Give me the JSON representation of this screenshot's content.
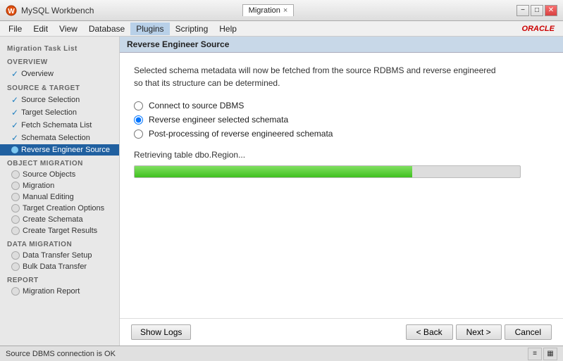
{
  "titleBar": {
    "appName": "MySQL Workbench",
    "tab": "Migration",
    "closeTabLabel": "×"
  },
  "menuBar": {
    "items": [
      "File",
      "Edit",
      "View",
      "Database",
      "Plugins",
      "Scripting",
      "Help"
    ],
    "activeItem": "Plugins",
    "oracleLogo": "ORACLE"
  },
  "sidebar": {
    "title": "Migration Task List",
    "sections": [
      {
        "label": "OVERVIEW",
        "items": [
          {
            "label": "Overview",
            "state": "check",
            "active": false
          }
        ]
      },
      {
        "label": "SOURCE & TARGET",
        "items": [
          {
            "label": "Source Selection",
            "state": "check",
            "active": false
          },
          {
            "label": "Target Selection",
            "state": "check",
            "active": false
          },
          {
            "label": "Fetch Schemata List",
            "state": "check",
            "active": false
          },
          {
            "label": "Schemata Selection",
            "state": "check",
            "active": false
          },
          {
            "label": "Reverse Engineer Source",
            "state": "active",
            "active": true
          }
        ]
      },
      {
        "label": "OBJECT MIGRATION",
        "items": [
          {
            "label": "Source Objects",
            "state": "circle",
            "active": false
          },
          {
            "label": "Migration",
            "state": "circle",
            "active": false
          },
          {
            "label": "Manual Editing",
            "state": "circle",
            "active": false
          },
          {
            "label": "Target Creation Options",
            "state": "circle",
            "active": false
          },
          {
            "label": "Create Schemata",
            "state": "circle",
            "active": false
          },
          {
            "label": "Create Target Results",
            "state": "circle",
            "active": false
          }
        ]
      },
      {
        "label": "DATA MIGRATION",
        "items": [
          {
            "label": "Data Transfer Setup",
            "state": "circle",
            "active": false
          },
          {
            "label": "Bulk Data Transfer",
            "state": "circle",
            "active": false
          }
        ]
      },
      {
        "label": "REPORT",
        "items": [
          {
            "label": "Migration Report",
            "state": "circle",
            "active": false
          }
        ]
      }
    ]
  },
  "content": {
    "header": "Reverse Engineer Source",
    "description": "Selected schema metadata will now be fetched from the source RDBMS and reverse engineered\nso that its structure can be determined.",
    "radioOptions": [
      {
        "label": "Connect to source DBMS",
        "checked": true
      },
      {
        "label": "Reverse engineer selected schemata",
        "checked": true
      },
      {
        "label": "Post-processing of reverse engineered schemata",
        "checked": false
      }
    ],
    "statusText": "Retrieving table dbo.Region...",
    "progressPercent": 72,
    "showLogsLabel": "Show Logs",
    "backLabel": "< Back",
    "nextLabel": "Next >",
    "cancelLabel": "Cancel"
  },
  "statusBar": {
    "text": "Source DBMS connection is OK"
  }
}
